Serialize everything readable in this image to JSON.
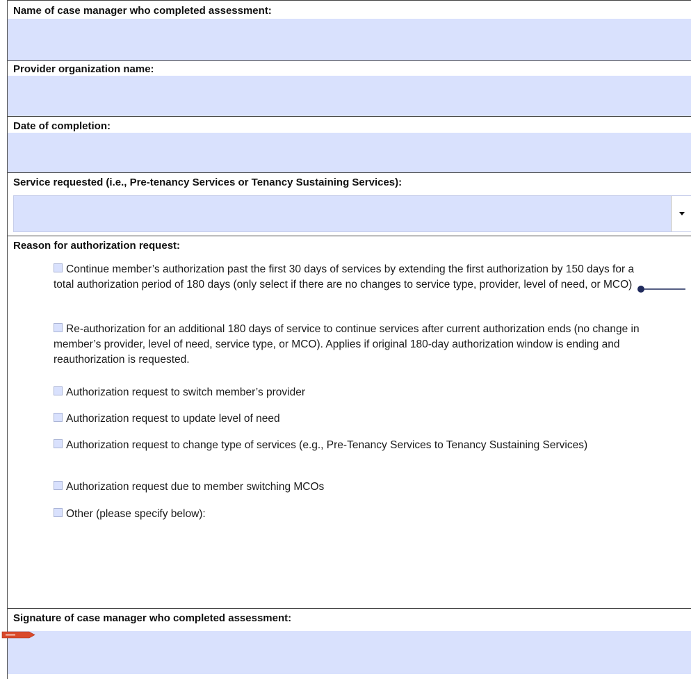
{
  "fields": {
    "case_manager_label": "Name of case manager who completed assessment:",
    "provider_label": "Provider organization name:",
    "date_label": "Date of completion:",
    "service_label": "Service requested (i.e., Pre-tenancy Services or Tenancy Sustaining Services):",
    "reason_label": "Reason for authorization request:",
    "signature_label": "Signature of case manager who completed assessment:"
  },
  "reasons": [
    "Continue member’s authorization past the first 30 days of services by extending the first authorization by 150 days for a total authorization period of 180 days (only select if there are no changes to service type, provider, level of need, or MCO)",
    "Re-authorization for an additional 180 days of service to continue services after current authorization ends (no change in member’s provider, level of need, service type, or MCO). Applies if original 180-day authorization window is ending and reauthorization is requested.",
    "Authorization request to switch member’s provider",
    "Authorization request to update level of need",
    "Authorization request to change type of services (e.g., Pre-Tenancy Services to Tenancy Sustaining Services)",
    "Authorization request due to member switching MCOs",
    "Other (please specify below):"
  ],
  "colors": {
    "field_fill": "#d9e1fd",
    "marker": "#1f2a5c",
    "tag": "#d9492b"
  }
}
